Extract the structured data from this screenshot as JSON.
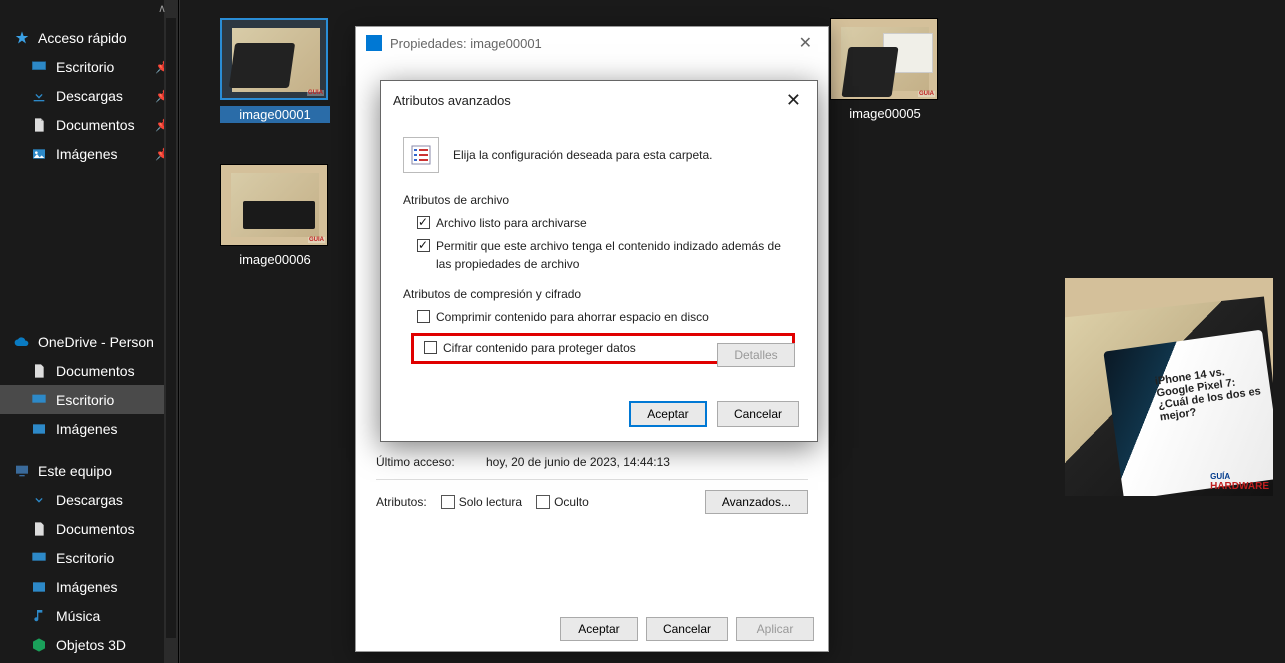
{
  "sidebar": {
    "quick_access": "Acceso rápido",
    "items_top": [
      {
        "label": "Escritorio"
      },
      {
        "label": "Descargas"
      },
      {
        "label": "Documentos"
      },
      {
        "label": "Imágenes"
      }
    ],
    "onedrive": "OneDrive - Person",
    "od_items": [
      {
        "label": "Documentos"
      },
      {
        "label": "Escritorio"
      },
      {
        "label": "Imágenes"
      }
    ],
    "this_pc": "Este equipo",
    "pc_items": [
      {
        "label": "Descargas"
      },
      {
        "label": "Documentos"
      },
      {
        "label": "Escritorio"
      },
      {
        "label": "Imágenes"
      },
      {
        "label": "Música"
      },
      {
        "label": "Objetos 3D"
      }
    ]
  },
  "files": {
    "f1": "image00001",
    "f5": "image00005",
    "f6": "image00006"
  },
  "dlg_prop": {
    "title": "Propiedades: image00001",
    "last_access_label": "Último acceso:",
    "last_access_val": "hoy, 20 de junio de 2023, 14:44:13",
    "attr_label": "Atributos:",
    "readonly": "Solo lectura",
    "hidden": "Oculto",
    "advanced_btn": "Avanzados...",
    "ok": "Aceptar",
    "cancel": "Cancelar",
    "apply": "Aplicar"
  },
  "dlg_adv": {
    "title": "Atributos avanzados",
    "intro": "Elija la configuración deseada para esta carpeta.",
    "group1": "Atributos de archivo",
    "opt1": "Archivo listo para archivarse",
    "opt2": "Permitir que este archivo tenga el contenido indizado además de las propiedades de archivo",
    "group2": "Atributos de compresión y cifrado",
    "opt3": "Comprimir contenido para ahorrar espacio en disco",
    "opt4": "Cifrar contenido para proteger datos",
    "details": "Detalles",
    "ok": "Aceptar",
    "cancel": "Cancelar"
  },
  "preview": {
    "headline": "iPhone 14 vs. Google Pixel 7: ¿Cuál de los dos es mejor?",
    "wm_top": "GUÍA",
    "wm_bot": "HARDWARE"
  }
}
